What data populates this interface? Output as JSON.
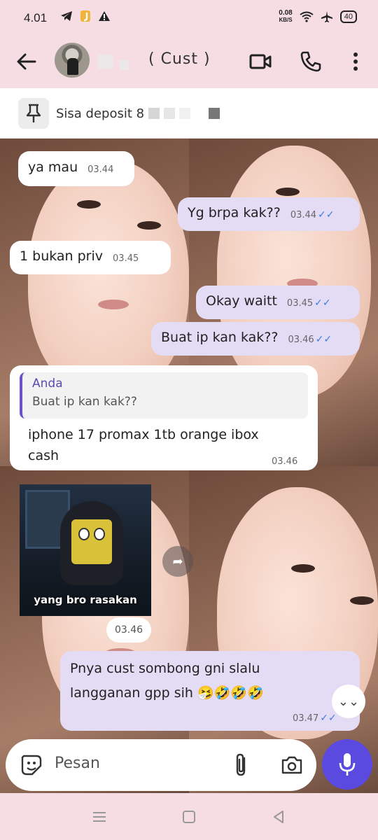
{
  "status_bar": {
    "time": "4.01",
    "left_icons": [
      "telegram-icon",
      "j-app-icon",
      "alert-icon"
    ],
    "net_speed_value": "0.08",
    "net_speed_unit": "KB/S",
    "battery": "40",
    "right_icons": [
      "wifi-icon",
      "airplane-icon",
      "battery-icon"
    ]
  },
  "header": {
    "contact_name": "( Cust )",
    "actions": [
      "back-arrow-icon",
      "video-call-icon",
      "phone-icon",
      "more-vertical-icon"
    ]
  },
  "pinned": {
    "text": "Sisa deposit 8",
    "icon": "pin-icon"
  },
  "messages": [
    {
      "dir": "in",
      "text": "ya mau",
      "time": "03.44"
    },
    {
      "dir": "out",
      "text": "Yg brpa kak??",
      "time": "03.44",
      "ticks": "✓✓"
    },
    {
      "dir": "in",
      "text": "1 bukan priv",
      "time": "03.45"
    },
    {
      "dir": "out",
      "text": "Okay waitt",
      "time": "03.45",
      "ticks": "✓✓"
    },
    {
      "dir": "out",
      "text": "Buat ip kan kak??",
      "time": "03.46",
      "ticks": "✓✓"
    },
    {
      "dir": "in",
      "reply_author": "Anda",
      "reply_text": "Buat ip kan kak??",
      "text_line1": "iphone 17 promax 1tb orange ibox",
      "text_line2": "cash",
      "time": "03.46"
    },
    {
      "dir": "in",
      "sticker_caption": "yang bro rasakan",
      "time": "03.46"
    },
    {
      "dir": "out",
      "text_line1": "Pnya cust sombong gni slalu",
      "text_line2": "langganan gpp sih 🤧🤣🤣🤣",
      "time": "03.47",
      "ticks": "✓✓"
    }
  ],
  "input": {
    "placeholder": "Pesan",
    "icons": [
      "sticker-icon",
      "attachment-icon",
      "camera-icon",
      "mic-icon"
    ]
  },
  "nav": {
    "icons": [
      "menu-nav-icon",
      "home-nav-icon",
      "back-nav-icon"
    ]
  },
  "colors": {
    "header_bg": "#f6dde4",
    "outgoing_bubble": "#e4dcf5",
    "incoming_bubble": "#ffffff",
    "accent": "#5a4ae0",
    "read_ticks": "#3e7be0"
  }
}
